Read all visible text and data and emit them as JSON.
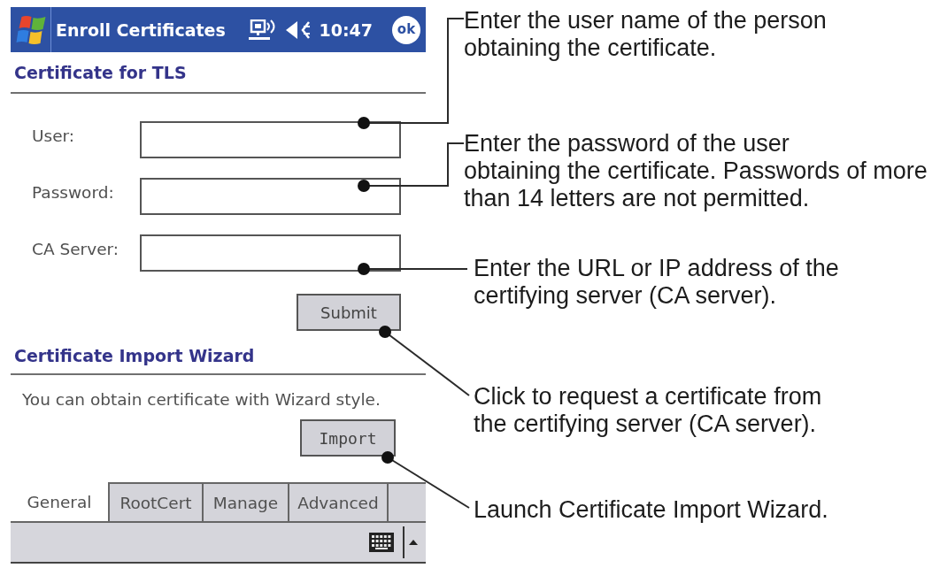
{
  "title_bar": {
    "title": "Enroll Certificates",
    "time": "10:47",
    "ok_label": "ok"
  },
  "tls_section": {
    "heading": "Certificate for TLS",
    "fields": [
      {
        "label": "User:"
      },
      {
        "label": "Password:"
      },
      {
        "label": "CA Server:"
      }
    ],
    "submit_label": "Submit"
  },
  "wizard_section": {
    "heading": "Certificate Import Wizard",
    "description": "You can obtain certificate with Wizard style.",
    "import_label": "Import"
  },
  "tabs": [
    {
      "label": "General",
      "selected": true
    },
    {
      "label": "RootCert",
      "selected": false
    },
    {
      "label": "Manage",
      "selected": false
    },
    {
      "label": "Advanced",
      "selected": false
    }
  ],
  "callouts": [
    {
      "lines": [
        "Enter the user name of the person",
        "obtaining the certificate."
      ]
    },
    {
      "lines": [
        "Enter the password of the user",
        "obtaining the certificate. Passwords of more",
        "than 14 letters are not permitted."
      ]
    },
    {
      "lines": [
        "Enter the URL or IP address of the",
        "certifying server (CA server)."
      ]
    },
    {
      "lines": [
        "Click to request a certificate from",
        "the certifying server (CA server)."
      ]
    },
    {
      "lines": [
        "Launch Certificate Import Wizard."
      ]
    }
  ]
}
